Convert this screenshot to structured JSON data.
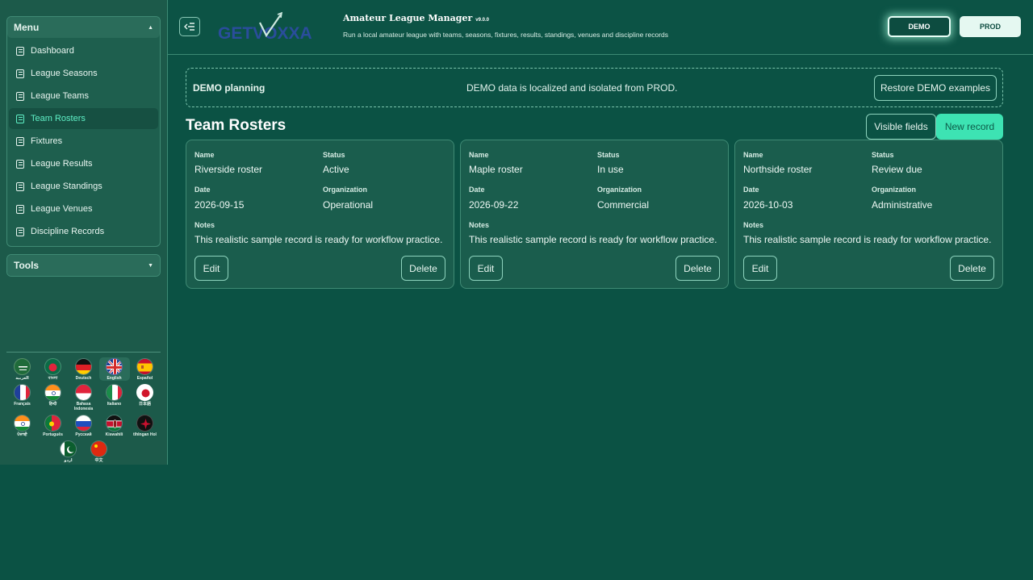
{
  "sidebar": {
    "menu_title": "Menu",
    "items": [
      {
        "label": "Dashboard"
      },
      {
        "label": "League Seasons"
      },
      {
        "label": "League Teams"
      },
      {
        "label": "Team Rosters",
        "active": true
      },
      {
        "label": "Fixtures"
      },
      {
        "label": "League Results"
      },
      {
        "label": "League Standings"
      },
      {
        "label": "League Venues"
      },
      {
        "label": "Discipline Records"
      }
    ],
    "tools_title": "Tools"
  },
  "languages": [
    {
      "label": "العربية",
      "flag": "saudi-arabia"
    },
    {
      "label": "বাংলা",
      "flag": "bangladesh"
    },
    {
      "label": "Deutsch",
      "flag": "germany"
    },
    {
      "label": "English",
      "flag": "united-kingdom",
      "selected": true
    },
    {
      "label": "Español",
      "flag": "spain"
    },
    {
      "label": "Français",
      "flag": "france"
    },
    {
      "label": "हिन्दी",
      "flag": "india"
    },
    {
      "label": "Bahasa Indonesia",
      "flag": "indonesia"
    },
    {
      "label": "Italiano",
      "flag": "italy"
    },
    {
      "label": "日本語",
      "flag": "japan"
    },
    {
      "label": "ਪੰਜਾਬੀ",
      "flag": "india"
    },
    {
      "label": "Português",
      "flag": "portugal"
    },
    {
      "label": "Русский",
      "flag": "russia"
    },
    {
      "label": "Kiswahili",
      "flag": "kenya"
    },
    {
      "label": "tlhIngan Hol",
      "flag": "klingon"
    },
    {
      "label": "اردو",
      "flag": "pakistan"
    },
    {
      "label": "中文",
      "flag": "china"
    }
  ],
  "header": {
    "logo_text": "GETVOXXA",
    "app_title": "Amateur League Manager",
    "version": "v9.0.0",
    "subtitle": "Run a local amateur league with teams, seasons, fixtures, results, standings, venues and discipline records",
    "demo_label": "DEMO",
    "prod_label": "PROD"
  },
  "banner": {
    "title": "DEMO planning",
    "text": "DEMO data is localized and isolated from PROD.",
    "restore_label": "Restore DEMO examples"
  },
  "page": {
    "title": "Team Rosters",
    "visible_fields_label": "Visible fields",
    "new_record_label": "New record"
  },
  "field_labels": {
    "name": "Name",
    "status": "Status",
    "date": "Date",
    "organization": "Organization",
    "notes": "Notes",
    "edit": "Edit",
    "delete": "Delete"
  },
  "cards": [
    {
      "name": "Riverside roster",
      "status": "Active",
      "date": "2026-09-15",
      "organization": "Operational",
      "notes": "This realistic sample record is ready for workflow practice."
    },
    {
      "name": "Maple roster",
      "status": "In use",
      "date": "2026-09-22",
      "organization": "Commercial",
      "notes": "This realistic sample record is ready for workflow practice."
    },
    {
      "name": "Northside roster",
      "status": "Review due",
      "date": "2026-10-03",
      "organization": "Administrative",
      "notes": "This realistic sample record is ready for workflow practice."
    }
  ],
  "colors": {
    "background": "#0b5244",
    "accent": "#3de3b3",
    "active_text": "#5ff0c6"
  }
}
